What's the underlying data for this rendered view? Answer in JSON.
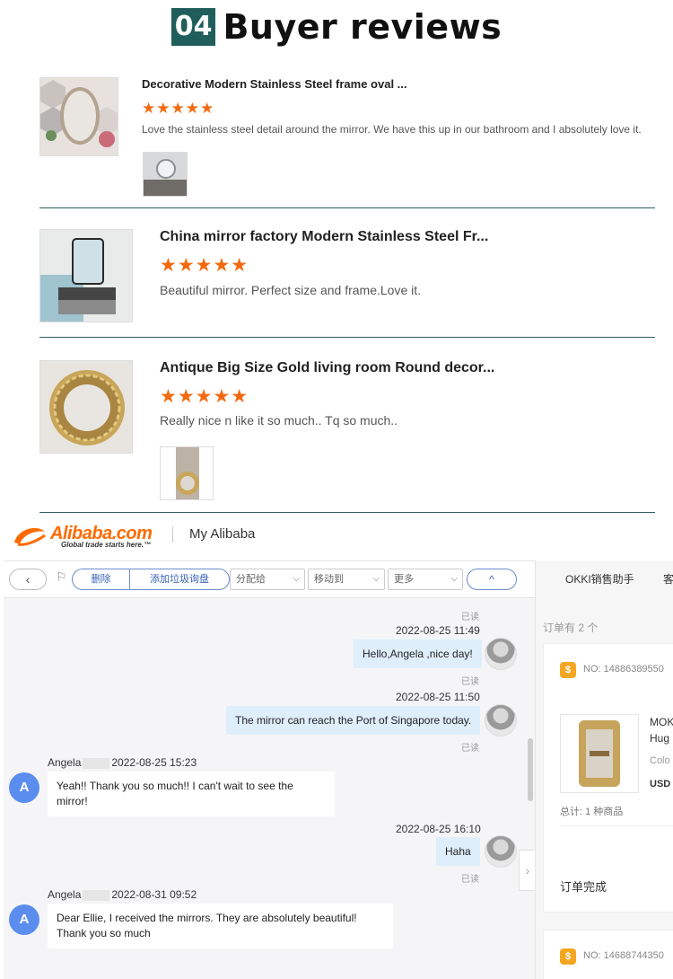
{
  "header": {
    "number": "04",
    "title": "Buyer reviews"
  },
  "reviews": [
    {
      "title": "Decorative Modern Stainless Steel frame oval ...",
      "stars": "★★★★★",
      "rating": 5,
      "text": "Love the stainless steel detail around the mirror. We have this up in our bathroom and I absolutely love it."
    },
    {
      "title": "China mirror factory Modern Stainless Steel Fr...",
      "stars": "★★★★★",
      "rating": 5,
      "text": "Beautiful mirror. Perfect size and frame.Love it."
    },
    {
      "title": "Antique Big Size Gold living room Round decor...",
      "stars": "★★★★★",
      "rating": 5,
      "text": "Really nice n like it so much.. Tq so much.."
    }
  ],
  "alibaba": {
    "logo_text": "Alibaba.com",
    "logo_sub": "Global trade starts here.™",
    "section": "My Alibaba"
  },
  "toolbar": {
    "back": "‹",
    "delete": "删除",
    "add_spam": "添加垃圾询盘",
    "assign": "分配给",
    "move": "移动到",
    "more": "更多",
    "up": "^"
  },
  "chat": {
    "read": "已读",
    "messages": [
      {
        "time": "2022-08-25 11:49",
        "text": "Hello,Angela ,nice day!"
      },
      {
        "time": "2022-08-25 11:50",
        "text": "The mirror can reach the Port of Singapore today."
      },
      {
        "user": "Angela",
        "time": "2022-08-25 15:23",
        "text": "Yeah!! Thank you so much!! I can't wait to see the mirror!"
      },
      {
        "time": "2022-08-25 16:10",
        "text": "Haha"
      },
      {
        "user": "Angela",
        "time": "2022-08-31 09:52",
        "text": "Dear Ellie, I received the mirrors. They are absolutely beautiful!",
        "text2": "Thank you so much"
      }
    ],
    "avatar_letter": "A"
  },
  "right_panel": {
    "tab1": "OKKI销售助手",
    "tab2": "客",
    "order_count": "订单有 2 个",
    "order1_no": "NO: 14886389550",
    "product_name1": "MOK",
    "product_name2": "Hug",
    "product_color": "Colo",
    "product_usd": "USD",
    "total": "总计: 1 种商品",
    "status": "订单完成",
    "order2_no": "NO: 14688744350"
  },
  "colors": {
    "accent": "#f26a10",
    "brand": "#ff6a00",
    "header_bg": "#1f5e5a",
    "bubble": "#dfeefb"
  }
}
